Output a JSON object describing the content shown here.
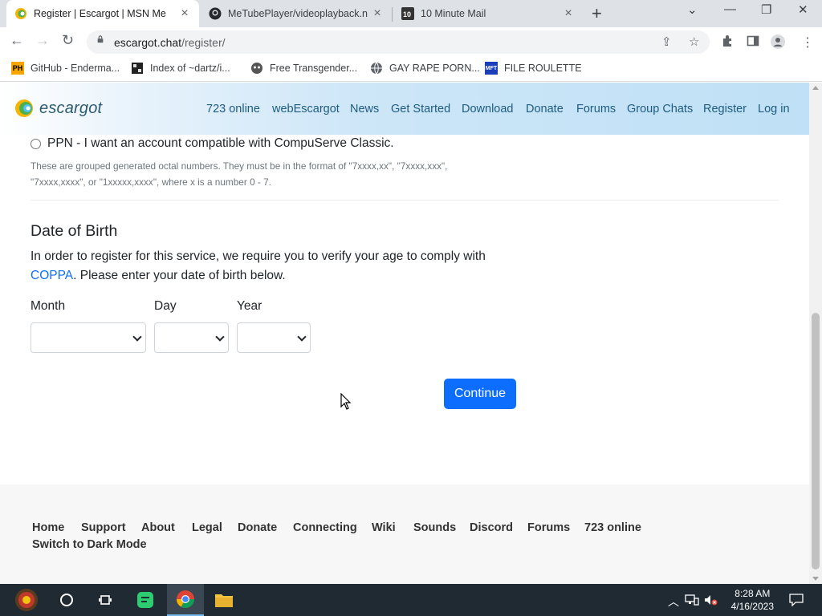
{
  "browser": {
    "tabs": [
      {
        "title": "Register | Escargot | MSN Me",
        "active": true
      },
      {
        "title": "MeTubePlayer/videoplayback.n",
        "active": false
      },
      {
        "title": "10 Minute Mail",
        "active": false
      }
    ],
    "url_host": "escargot.chat",
    "url_path": "/register/",
    "bookmarks": [
      {
        "label": "GitHub - Enderma...",
        "icon": "ph-icon"
      },
      {
        "label": "Index of ~dartz/i...",
        "icon": "folder-index-icon"
      },
      {
        "label": "Free Transgender...",
        "icon": "mask-icon"
      },
      {
        "label": "GAY RAPE PORN...",
        "icon": "globe-icon"
      },
      {
        "label": "FILE ROULETTE",
        "icon": "mft-icon"
      }
    ]
  },
  "site": {
    "logo_text": "escargot",
    "nav": [
      "723 online",
      "webEscargot",
      "News",
      "Get Started",
      "Download",
      "Donate",
      "Forums",
      "Group Chats",
      "Register",
      "Log in"
    ]
  },
  "form": {
    "ppn_label": "PPN - I want an account compatible with CompuServe Classic.",
    "ppn_hint": "These are grouped generated octal numbers. They must be in the format of \"7xxxx,xx\", \"7xxxx,xxx\", \"7xxxx,xxxx\", or \"1xxxxx,xxxx\", where x is a number 0 - 7.",
    "dob_title": "Date of Birth",
    "dob_text_before": "In order to register for this service, we require you to verify your age to comply with ",
    "dob_link": "COPPA",
    "dob_text_after": ". Please enter your date of birth below.",
    "month_label": "Month",
    "day_label": "Day",
    "year_label": "Year",
    "month_value": "",
    "day_value": "",
    "year_value": "",
    "continue_label": "Continue"
  },
  "footer": {
    "links": [
      "Home",
      "Support",
      "About",
      "Legal",
      "Donate",
      "Connecting",
      "Wiki",
      "Sounds",
      "Discord",
      "Forums",
      "723 online"
    ],
    "dark_mode": "Switch to Dark Mode"
  },
  "taskbar": {
    "time": "8:28 AM",
    "date": "4/16/2023"
  }
}
